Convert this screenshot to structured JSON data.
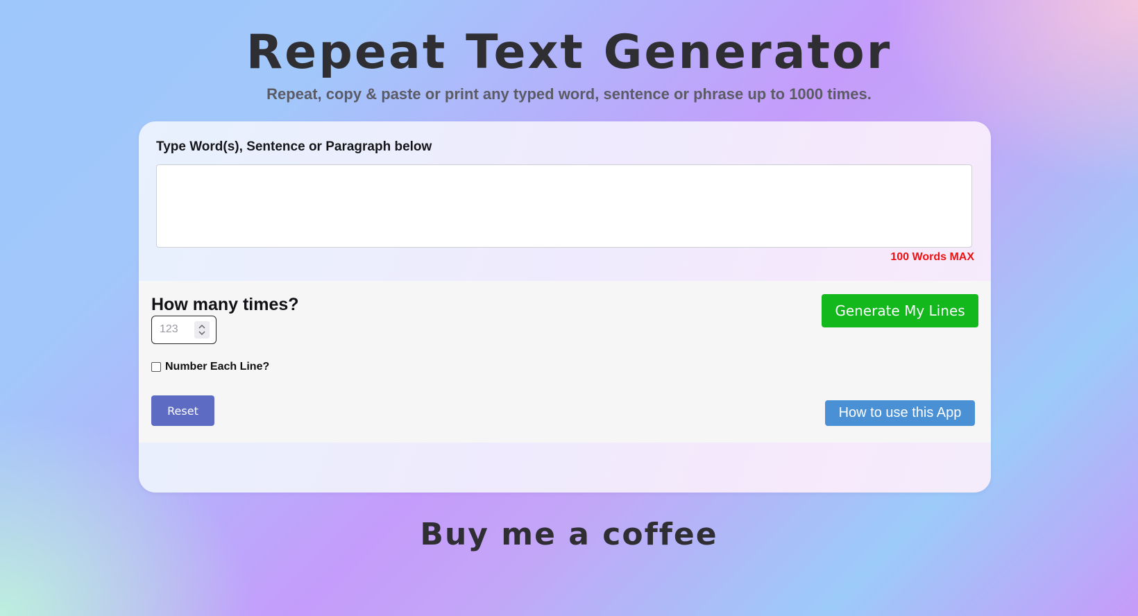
{
  "header": {
    "title": "Repeat Text Generator",
    "subtitle": "Repeat, copy & paste or print any typed word, sentence or phrase up to 1000 times."
  },
  "form": {
    "input_label": "Type Word(s), Sentence or Paragraph below",
    "text_value": "",
    "max_note": "100 Words MAX",
    "times_label": "How many times?",
    "times_placeholder": "123",
    "number_lines_label": "Number Each Line?",
    "number_lines_checked": false,
    "generate_label": "Generate My Lines",
    "reset_label": "Reset",
    "howto_label": "How to use this App"
  },
  "footer": {
    "coffee_label": "Buy me a coffee"
  },
  "colors": {
    "generate": "#12b81c",
    "reset": "#5e6bc2",
    "howto": "#4a90d4",
    "max_note": "#ee1111"
  }
}
